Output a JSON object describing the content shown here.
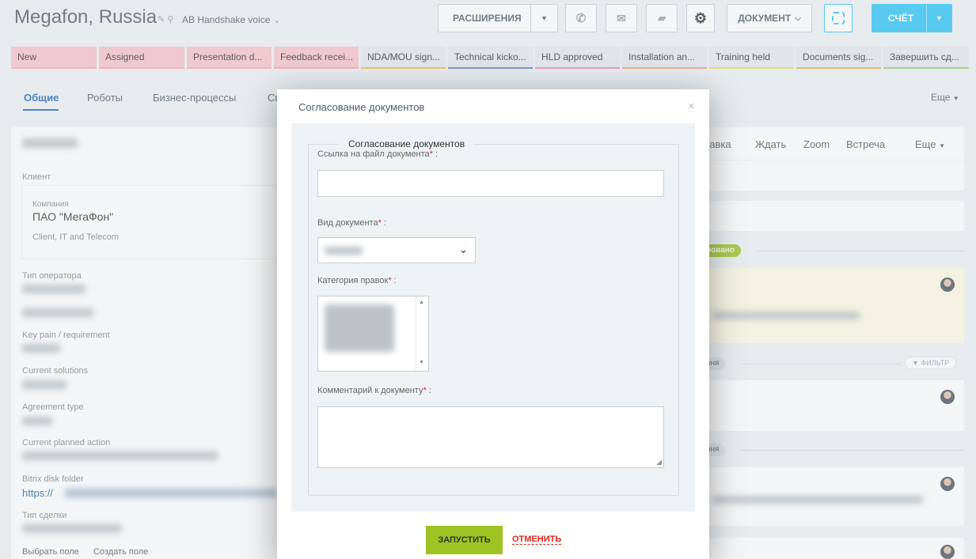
{
  "header": {
    "title": "Megafon,  Russia",
    "subtitle": "AB Handshake voice",
    "extensions_label": "РАСШИРЕНИЯ",
    "document_label": "ДОКУМЕНТ",
    "invoice_label": "СЧЁТ"
  },
  "stages": [
    {
      "label": "New",
      "color": "#f7c5cb",
      "border": "#f7a8b1"
    },
    {
      "label": "Assigned",
      "color": "#f7c5cb",
      "border": "#f7a8b1"
    },
    {
      "label": "Presentation d...",
      "color": "#f7c5cb",
      "border": "#f7a8b1"
    },
    {
      "label": "Feedback recei...",
      "color": "#f7c5cb",
      "border": "#f7a8b1"
    },
    {
      "label": "NDA/MOU sign...",
      "color": "#e6e9ec",
      "border": "#e0c24a"
    },
    {
      "label": "Technical kicko...",
      "color": "#e6e9ec",
      "border": "#6a7bd6"
    },
    {
      "label": "HLD approved",
      "color": "#e6e9ec",
      "border": "#e98fa8"
    },
    {
      "label": "Installation an...",
      "color": "#e6e9ec",
      "border": "#f0a07a"
    },
    {
      "label": "Training held",
      "color": "#e6e9ec",
      "border": "#e7e16a"
    },
    {
      "label": "Documents sig...",
      "color": "#e6e9ec",
      "border": "#f0b05a"
    },
    {
      "label": "Завершить сд...",
      "color": "#e6e9ec",
      "border": "#9ad27a"
    }
  ],
  "tabs": {
    "general": "Общие",
    "robots": "Роботы",
    "bp": "Бизнес-процессы",
    "cut": "Св",
    "more": "Еще"
  },
  "left_panel": {
    "client_label": "Клиент",
    "company_label": "Компания",
    "company_name": "ПАО \"МегаФон\"",
    "company_type": "Client, IT and Telecom",
    "field_operator_type": "Тип оператора",
    "field_key_pain": "Key pain / requirement",
    "field_current_solutions": "Current solutions",
    "field_agreement_type": "Agreement type",
    "field_planned_action": "Current planned action",
    "field_disk_folder": "Bitrix disk folder",
    "disk_folder_prefix": "https://",
    "field_deal_type": "Тип сделки",
    "select_field": "Выбрать поле",
    "create_field": "Создать поле"
  },
  "right_panel": {
    "actions": {
      "paste": "ставка",
      "wait": "Ждать",
      "zoom": "Zoom",
      "meeting": "Встреча",
      "more": "Еще"
    },
    "badge_status": "ровано",
    "today_1": "ння",
    "filter": "ФИЛЬТР",
    "today_2": "ння"
  },
  "modal": {
    "title": "Согласование документов",
    "fieldset_legend": "Согласование документов",
    "doc_link_label": "Ссылка на файл документа",
    "doc_type_label": "Вид документа",
    "category_label": "Категория правок",
    "comment_label": "Комментарий к документу",
    "submit_label": "ЗАПУСТИТЬ",
    "cancel_label": "ОТМЕНИТЬ",
    "close_glyph": "×"
  },
  "colors": {
    "accent": "#2fc6f6",
    "submit": "#9dc423",
    "cancel": "#e0261a",
    "link": "#2067b0",
    "tab_active": "#2067b0"
  }
}
